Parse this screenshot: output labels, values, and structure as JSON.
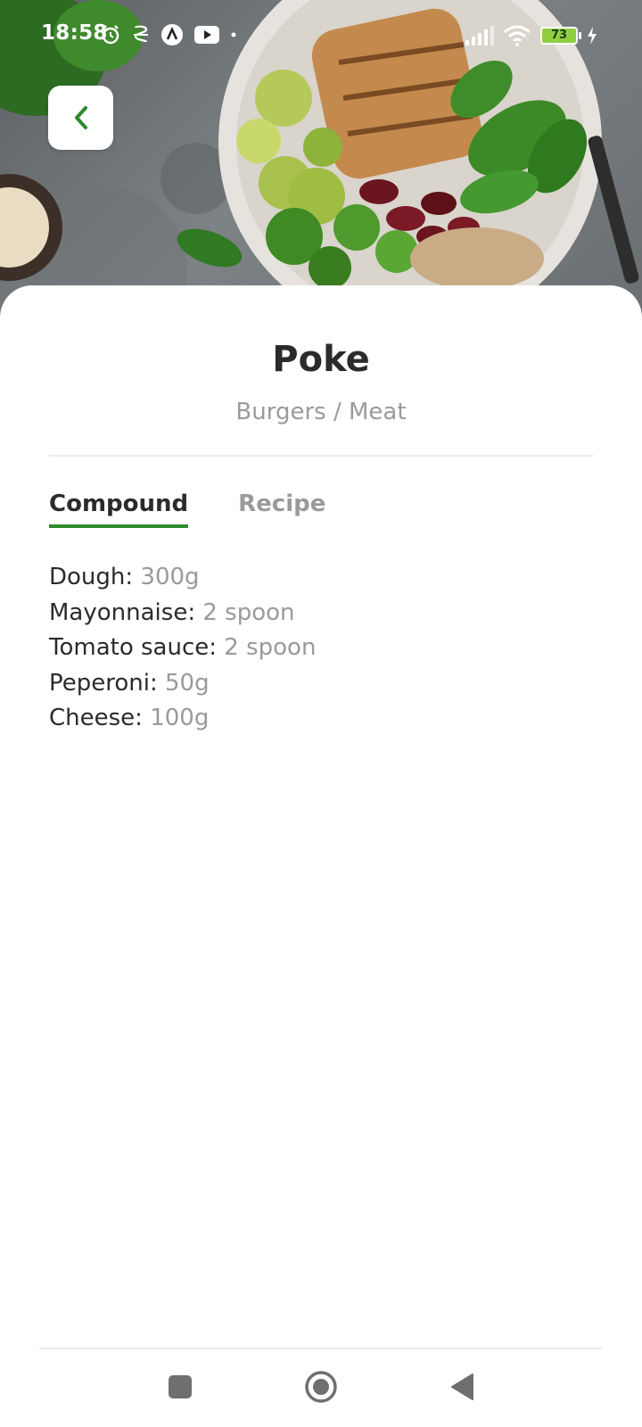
{
  "status_bar": {
    "time": "18:58",
    "battery_level": "73"
  },
  "dish": {
    "title": "Poke",
    "category": "Burgers / Meat"
  },
  "tabs": [
    {
      "label": "Compound",
      "active": true
    },
    {
      "label": "Recipe",
      "active": false
    }
  ],
  "ingredients": [
    {
      "name": "Dough:",
      "quantity": "300g"
    },
    {
      "name": "Mayonnaise:",
      "quantity": "2 spoon"
    },
    {
      "name": "Tomato sauce:",
      "quantity": "2 spoon"
    },
    {
      "name": "Peperoni:",
      "quantity": "50g"
    },
    {
      "name": "Cheese:",
      "quantity": "100g"
    }
  ],
  "icons": {
    "back": "chevron-left-icon",
    "nav_recents": "square-icon",
    "nav_home": "circle-icon",
    "nav_back": "triangle-left-icon"
  },
  "colors": {
    "accent": "#2e8b2e",
    "title": "#2b2b2b",
    "muted": "#9a9a9a",
    "battery": "#8fce43"
  }
}
